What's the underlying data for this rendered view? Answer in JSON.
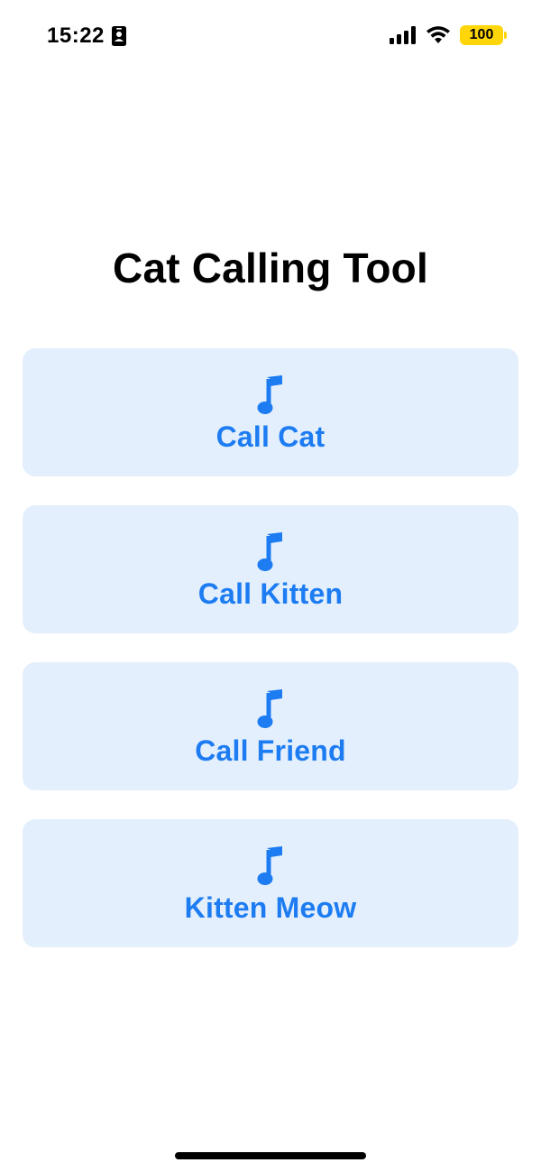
{
  "status_bar": {
    "time": "15:22",
    "battery_level": "100",
    "icons": {
      "id": "id-card-icon",
      "signal": "cellular-signal-icon",
      "wifi": "wifi-icon"
    },
    "battery_color": "#ffd60a"
  },
  "header": {
    "title": "Cat Calling Tool"
  },
  "buttons": [
    {
      "label": "Call Cat",
      "icon": "music-note-icon"
    },
    {
      "label": "Call Kitten",
      "icon": "music-note-icon"
    },
    {
      "label": "Call Friend",
      "icon": "music-note-icon"
    },
    {
      "label": "Kitten Meow",
      "icon": "music-note-icon"
    }
  ],
  "colors": {
    "accent": "#1d7cf2",
    "button_background": "#e3effd"
  }
}
